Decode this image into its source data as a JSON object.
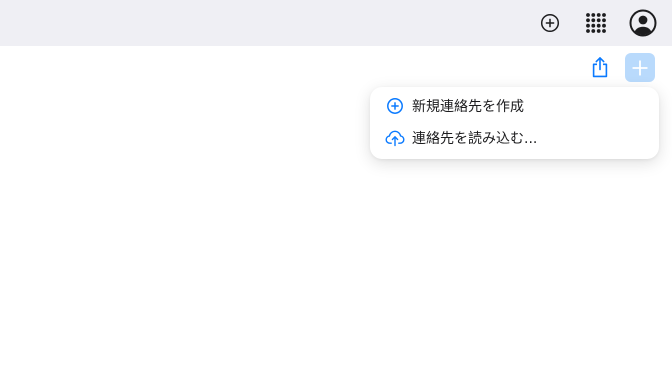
{
  "toolbar": {
    "icons": [
      "add-circle-icon",
      "apps-grid-icon",
      "account-icon"
    ]
  },
  "actions": {
    "icons": [
      "share-icon",
      "plus-icon"
    ]
  },
  "menu": {
    "items": [
      {
        "label": "新規連絡先を作成",
        "icon": "add-circle-icon"
      },
      {
        "label": "連絡先を読み込む...",
        "icon": "cloud-upload-icon"
      }
    ]
  },
  "colors": {
    "topbar_bg": "#efeff4",
    "accent": "#0a7aff",
    "add_button_bg": "#b9dafc",
    "text": "#1d1d1f"
  }
}
